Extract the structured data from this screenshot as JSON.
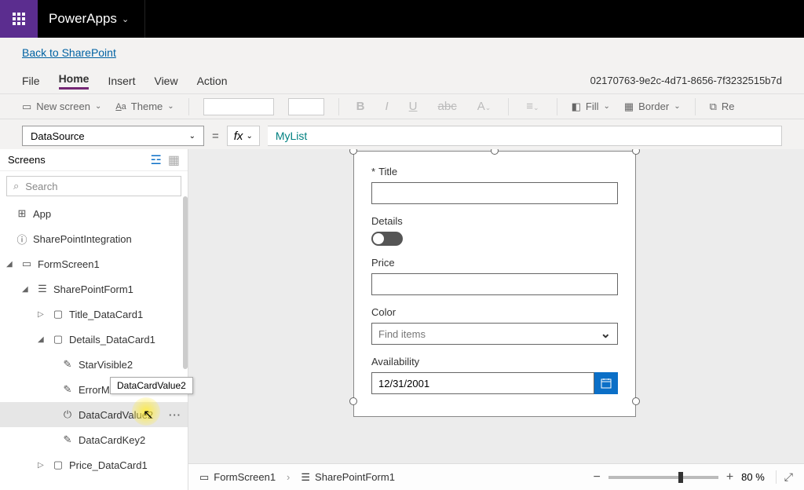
{
  "titlebar": {
    "app_name": "PowerApps"
  },
  "backrow": {
    "link": "Back to SharePoint"
  },
  "menu": {
    "tabs": [
      "File",
      "Home",
      "Insert",
      "View",
      "Action"
    ],
    "active": "Home",
    "doc_id": "02170763-9e2c-4d71-8656-7f3232515b7d"
  },
  "ribbon": {
    "new_screen": "New screen",
    "theme": "Theme",
    "fill": "Fill",
    "border": "Border",
    "re": "Re"
  },
  "formula": {
    "property": "DataSource",
    "fx": "fx",
    "value": "MyList",
    "eq": "="
  },
  "tree": {
    "title": "Screens",
    "search_placeholder": "Search",
    "items": {
      "app": "App",
      "spint": "SharePointIntegration",
      "formscreen": "FormScreen1",
      "spform": "SharePointForm1",
      "title_dc": "Title_DataCard1",
      "details_dc": "Details_DataCard1",
      "starvis": "StarVisible2",
      "errorm": "ErrorM",
      "dcval": "DataCardValue2",
      "dckey": "DataCardKey2",
      "price_dc": "Price_DataCard1"
    },
    "tooltip": "DataCardValue2"
  },
  "form": {
    "title": {
      "label": "Title",
      "required": "*"
    },
    "details": {
      "label": "Details"
    },
    "price": {
      "label": "Price"
    },
    "color": {
      "label": "Color",
      "placeholder": "Find items"
    },
    "availability": {
      "label": "Availability",
      "value": "12/31/2001"
    }
  },
  "status": {
    "crumb1": "FormScreen1",
    "crumb2": "SharePointForm1",
    "zoom_pct": "80 %"
  }
}
